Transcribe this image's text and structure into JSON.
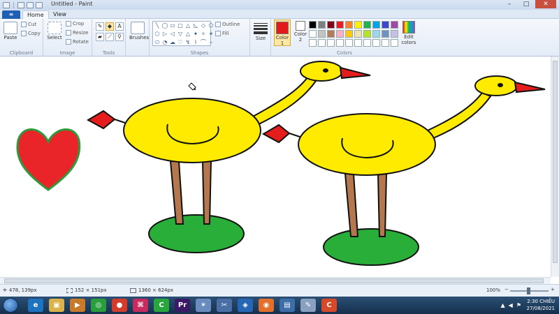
{
  "window": {
    "title": "Untitled - Paint",
    "minimize": "–",
    "maximize": "□",
    "close": "✕"
  },
  "tabs": {
    "file_icon": "≡",
    "home": "Home",
    "view": "View"
  },
  "ribbon": {
    "clipboard": {
      "paste": "Paste",
      "cut": "Cut",
      "copy": "Copy",
      "label": "Clipboard"
    },
    "image": {
      "select": "Select",
      "crop": "Crop",
      "resize": "Resize",
      "rotate": "Rotate",
      "label": "Image"
    },
    "tools": {
      "label": "Tools",
      "text_tool": "A"
    },
    "brushes": {
      "label": "Brushes"
    },
    "shapes": {
      "label": "Shapes",
      "outline": "Outline",
      "fill": "Fill",
      "glyphs": [
        "╲",
        "◯",
        "▭",
        "▢",
        "△",
        "◺",
        "◇",
        "⬠",
        "⬡",
        "▷",
        "◁",
        "▽",
        "△",
        "✦",
        "✧",
        "✶",
        "⬭",
        "◔",
        "☁",
        "♡",
        "↯",
        "⌇",
        "⌒",
        "⌢"
      ]
    },
    "size": {
      "label": "Size"
    },
    "colors": {
      "color1": "Color 1",
      "color2": "Color 2",
      "edit": "Edit colors",
      "label": "Colors",
      "color1_value": "#e31a1c",
      "color2_value": "#ffffff",
      "palette": [
        "#000000",
        "#7f7f7f",
        "#880015",
        "#ed1c24",
        "#ff7f27",
        "#fff200",
        "#22b14c",
        "#00a2e8",
        "#3f48cc",
        "#a349a4",
        "#ffffff",
        "#c3c3c3",
        "#b97a57",
        "#ffaec9",
        "#ffc90e",
        "#efe4b0",
        "#b5e61d",
        "#99d9ea",
        "#7092be",
        "#c8bfe7",
        "#ffffff",
        "#ffffff",
        "#ffffff",
        "#ffffff",
        "#ffffff",
        "#ffffff",
        "#ffffff",
        "#ffffff",
        "#ffffff",
        "#ffffff"
      ]
    }
  },
  "drawing": {
    "fill_yellow": "#ffeb00",
    "leg_brown": "#b5784e",
    "grass_green": "#2aae3a",
    "heart_red": "#e9252a",
    "heart_outline": "#2e9a3b",
    "beak_red": "#e51d1d"
  },
  "status": {
    "cursor": "478, 139px",
    "selection": "152 × 151px",
    "image_size": "1360 × 624px",
    "zoom": "100%"
  },
  "taskbar": {
    "icons": [
      "e",
      "▣",
      "▶",
      "◎",
      "●",
      "⌘",
      "C",
      "Pr",
      "✶",
      "✂",
      "◈",
      "◉",
      "▤",
      "✎",
      "C"
    ],
    "time": "2:30 CHIỀU",
    "date": "27/08/2021"
  }
}
